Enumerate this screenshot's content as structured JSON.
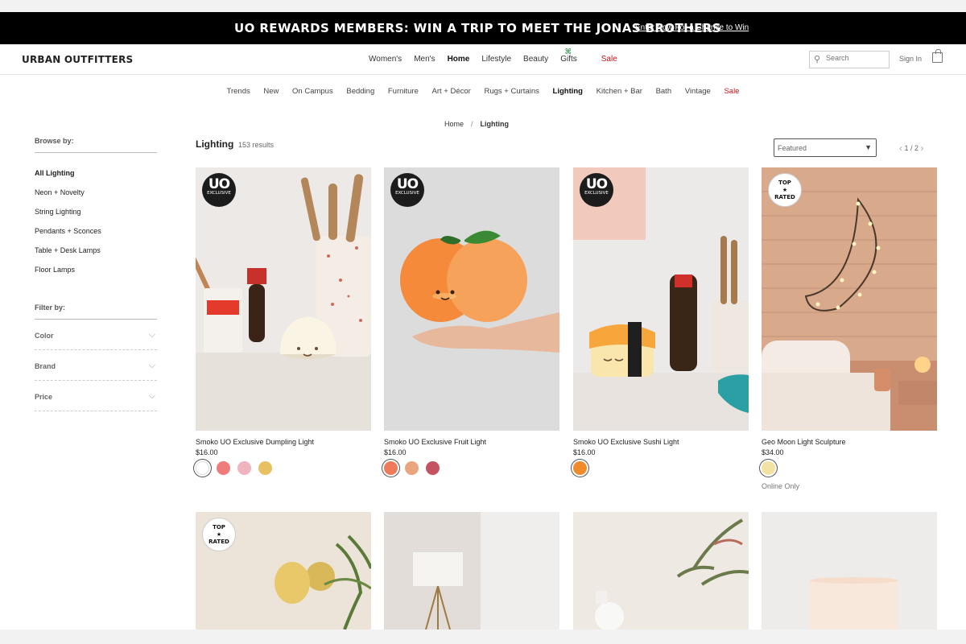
{
  "promo": {
    "title": "UO REWARDS MEMBERS: WIN A TRIP TO MEET THE JONAS BROTHERS",
    "link": "Enter Now For a Chance to Win"
  },
  "header": {
    "logo": "URBAN OUTFITTERS",
    "nav": [
      "Women's",
      "Men's",
      "Home",
      "Lifestyle",
      "Beauty",
      "Gifts",
      "Sale"
    ],
    "search_placeholder": "Search",
    "sign_in": "Sign In"
  },
  "subnav": [
    "Trends",
    "New",
    "On Campus",
    "Bedding",
    "Furniture",
    "Art + Décor",
    "Rugs + Curtains",
    "Lighting",
    "Kitchen + Bar",
    "Bath",
    "Vintage",
    "Sale"
  ],
  "breadcrumb": {
    "home": "Home",
    "sep": "/",
    "current": "Lighting"
  },
  "sidebar": {
    "browse_heading": "Browse by:",
    "categories": [
      "All Lighting",
      "Neon + Novelty",
      "String Lighting",
      "Pendants + Sconces",
      "Table + Desk Lamps",
      "Floor Lamps"
    ],
    "filter_heading": "Filter by:",
    "filters": [
      "Color",
      "Brand",
      "Price"
    ]
  },
  "results": {
    "title": "Lighting",
    "count": "153 results",
    "sort": "Featured",
    "page": "1 / 2"
  },
  "badges": {
    "uo_big": "UO",
    "uo_small": "EXCLUSIVE",
    "top": "TOP",
    "star": "★",
    "rated": "RATED"
  },
  "products": [
    {
      "name": "Smoko UO Exclusive Dumpling Light",
      "price": "$16.00",
      "swatches": [
        "#ffffff",
        "#f07b7b",
        "#f0b3c0",
        "#e8c060"
      ],
      "online": ""
    },
    {
      "name": "Smoko UO Exclusive Fruit Light",
      "price": "$16.00",
      "swatches": [
        "#f07a5a",
        "#e8a57e",
        "#c55460"
      ],
      "online": ""
    },
    {
      "name": "Smoko UO Exclusive Sushi Light",
      "price": "$16.00",
      "swatches": [
        "#f08a2a"
      ],
      "online": ""
    },
    {
      "name": "Geo Moon Light Sculpture",
      "price": "$34.00",
      "swatches": [
        "#f3e3a3"
      ],
      "online": "Online Only"
    }
  ]
}
